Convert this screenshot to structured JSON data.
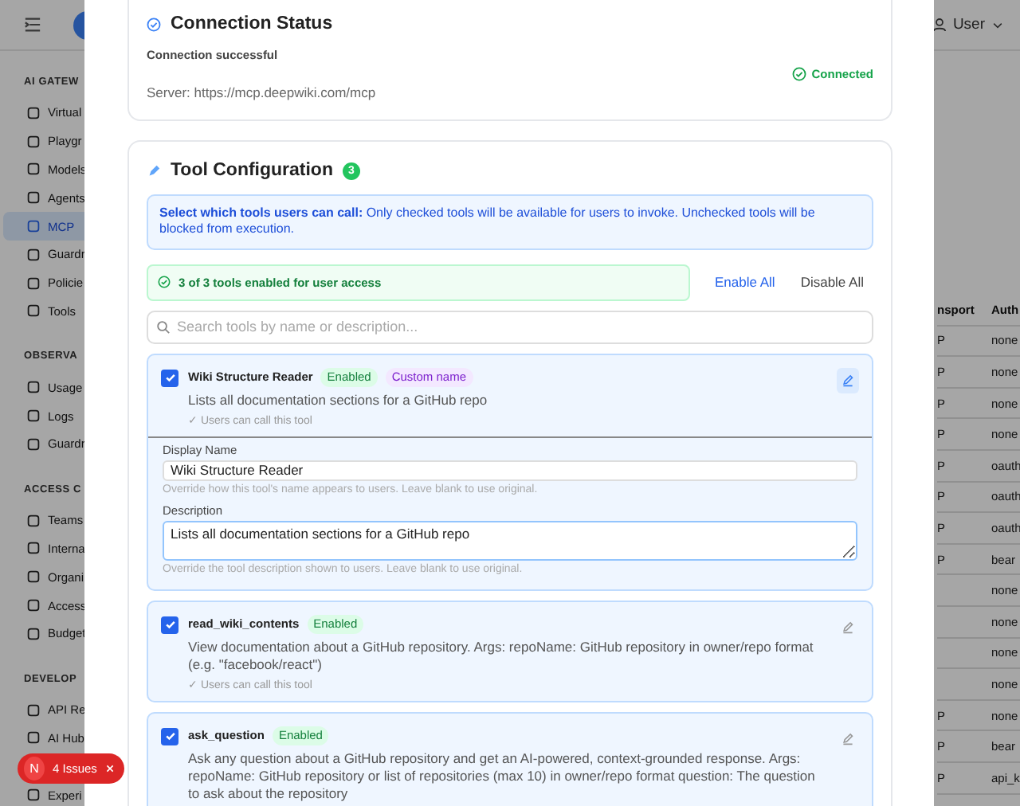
{
  "sidebar": {
    "sections": [
      {
        "title": "AI GATEW",
        "items": [
          {
            "label": "Virtual",
            "selected": false
          },
          {
            "label": "Playgr",
            "selected": false
          },
          {
            "label": "Models",
            "selected": false
          },
          {
            "label": "Agents",
            "selected": false
          },
          {
            "label": "MCP",
            "selected": true
          },
          {
            "label": "Guardr",
            "selected": false
          },
          {
            "label": "Policie",
            "selected": false
          },
          {
            "label": "Tools",
            "selected": false
          }
        ]
      },
      {
        "title": "OBSERVA",
        "items": [
          {
            "label": "Usage",
            "selected": false
          },
          {
            "label": "Logs",
            "selected": false
          },
          {
            "label": "Guardr",
            "selected": false
          }
        ]
      },
      {
        "title": "ACCESS C",
        "items": [
          {
            "label": "Teams",
            "selected": false
          },
          {
            "label": "Interna",
            "selected": false
          },
          {
            "label": "Organi",
            "selected": false
          },
          {
            "label": "Access",
            "selected": false
          },
          {
            "label": "Budget",
            "selected": false
          }
        ]
      },
      {
        "title": "DEVELOP",
        "items": [
          {
            "label": "API Re",
            "selected": false
          },
          {
            "label": "AI Hub",
            "selected": false
          },
          {
            "label": "Experi",
            "selected": false
          }
        ]
      }
    ]
  },
  "header": {
    "user": "User"
  },
  "table": {
    "columns": [
      "nsport",
      "Auth"
    ],
    "rows": [
      [
        "P",
        "none"
      ],
      [
        "P",
        "none"
      ],
      [
        "P",
        "none"
      ],
      [
        "P",
        "none"
      ],
      [
        "P",
        "oauth"
      ],
      [
        "P",
        "oauth"
      ],
      [
        "P",
        "oauth"
      ],
      [
        "P",
        "bear"
      ],
      [
        "",
        "none"
      ],
      [
        "",
        "none"
      ],
      [
        "",
        "none"
      ],
      [
        "",
        "none"
      ],
      [
        "P",
        "none"
      ],
      [
        "P",
        "bear"
      ],
      [
        "P",
        "api_k"
      ]
    ]
  },
  "connection": {
    "title": "Connection Status",
    "message": "Connection successful",
    "server": "Server: https://mcp.deepwiki.com/mcp",
    "status": "Connected"
  },
  "tool_config": {
    "title": "Tool Configuration",
    "count": "3",
    "info": "**Select which tools users can call:** Only checked tools will be available for users to invoke. Unchecked tools will be blocked from execution.",
    "summary": "3 of 3 tools enabled for user access",
    "enable_all": "Enable All",
    "disable_all": "Disable All",
    "search": {
      "placeholder": "Search tools by name or description..."
    },
    "tools": [
      {
        "name": "Wiki Structure Reader",
        "checked": true,
        "editing": true,
        "badges": [
          {
            "label": "Enabled",
            "kind": "status"
          },
          {
            "label": "Custom name",
            "kind": "custom"
          }
        ],
        "description": "Lists all documentation sections for a GitHub repo",
        "note": "✓ Users can call this tool",
        "form": {
          "name_label": "Display Name",
          "name_value": "Wiki Structure Reader",
          "name_hint": "Override how this tool's name appears to users. Leave blank to use original.",
          "desc_label": "Description",
          "desc_value": "Lists all documentation sections for a GitHub repo",
          "desc_hint": "Override the tool description shown to users. Leave blank to use original."
        }
      },
      {
        "name": "read_wiki_contents",
        "checked": true,
        "editing": false,
        "badges": [
          {
            "label": "Enabled",
            "kind": "status"
          }
        ],
        "description": "View documentation about a GitHub repository. Args: repoName: GitHub repository in owner/repo format (e.g. \"facebook/react\")",
        "note": "✓ Users can call this tool"
      },
      {
        "name": "ask_question",
        "checked": true,
        "editing": false,
        "badges": [
          {
            "label": "Enabled",
            "kind": "status"
          }
        ],
        "description": "Ask any question about a GitHub repository and get an AI-powered, context-grounded response. Args: repoName: GitHub repository or list of repositories (max 10) in owner/repo format question: The question to ask about the repository"
      }
    ]
  },
  "issues_toast": {
    "avatar": "N",
    "label": "4 Issues"
  }
}
